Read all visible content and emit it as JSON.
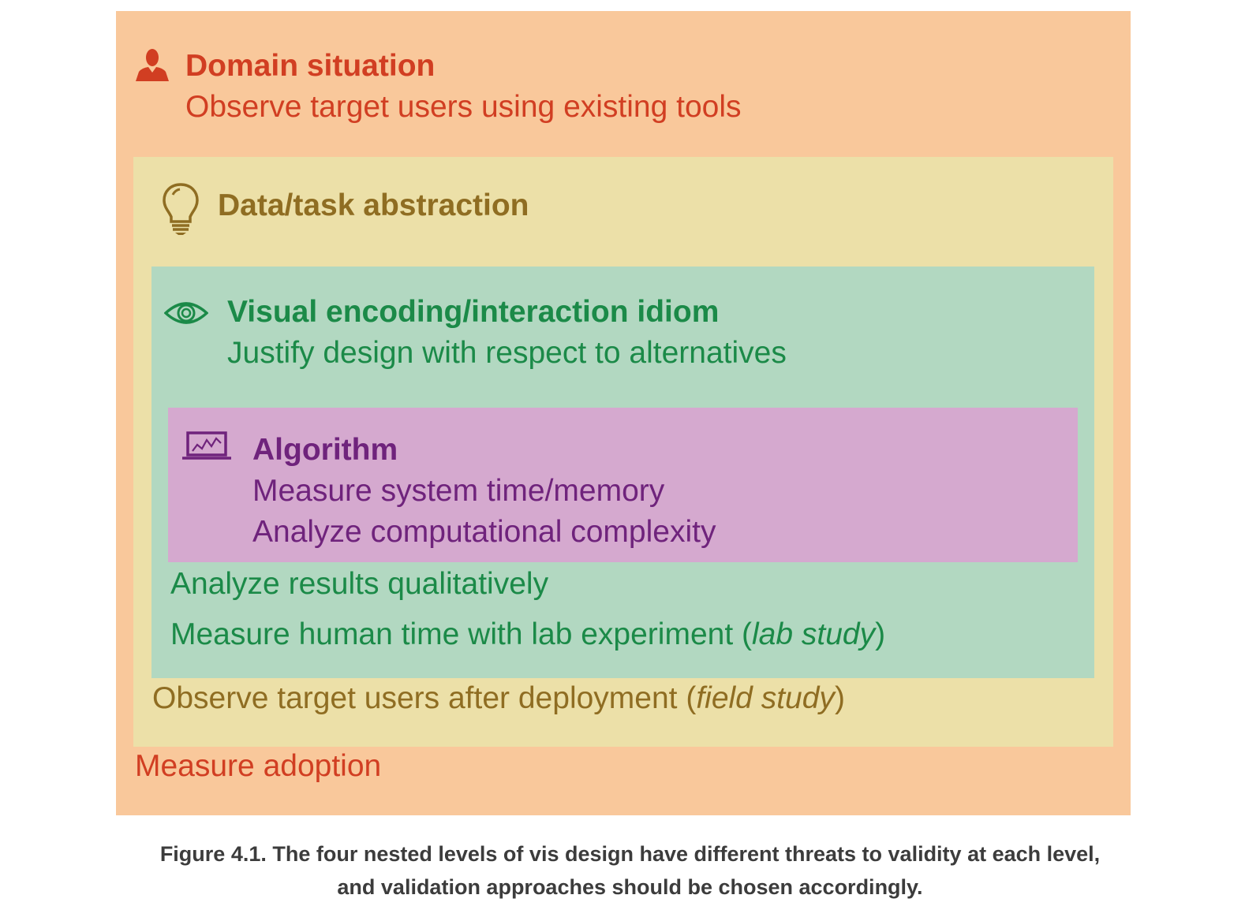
{
  "levels": {
    "domain": {
      "title": "Domain situation",
      "method_top": "Observe target users using existing tools",
      "method_bottom": "Measure adoption",
      "icon": "person-icon",
      "color": "#d13e22",
      "background": "#f9c89b"
    },
    "datatask": {
      "title": "Data/task abstraction",
      "method_bottom_prefix": "Observe target users after deployment (",
      "method_bottom_italic": "field study",
      "method_bottom_suffix": ")",
      "icon": "lightbulb-icon",
      "color": "#8f6d22",
      "background": "#ece0a8"
    },
    "visual": {
      "title": "Visual encoding/interaction idiom",
      "method_top": "Justify design with respect to alternatives",
      "method_bottom_1": "Analyze results qualitatively",
      "method_bottom_2_prefix": "Measure human time with lab experiment (",
      "method_bottom_2_italic": "lab study",
      "method_bottom_2_suffix": ")",
      "icon": "eye-icon",
      "color": "#1b8a48",
      "background": "#b2d8c1"
    },
    "algorithm": {
      "title": "Algorithm",
      "method_1": "Measure system time/memory",
      "method_2": "Analyze computational complexity",
      "icon": "laptop-icon",
      "color": "#6f237c",
      "background": "#d5a9cf"
    }
  },
  "caption": {
    "line1": "Figure 4.1. The four nested levels of vis design have different threats to validity at each level,",
    "line2": "and validation approaches should be chosen accordingly."
  }
}
